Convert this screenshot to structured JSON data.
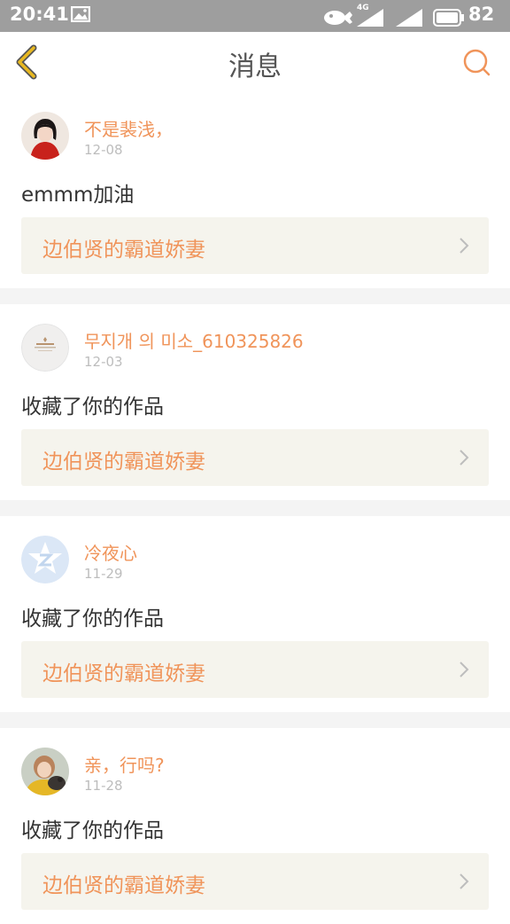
{
  "status_bar": {
    "time": "20:41",
    "network": "4G",
    "battery": "82",
    "icons": [
      "image-notification-icon",
      "cloud-icon",
      "signal-icon",
      "signal-icon",
      "battery-icon"
    ]
  },
  "header": {
    "title": "消息",
    "back_icon": "chevron-left-icon",
    "search_icon": "search-icon"
  },
  "colors": {
    "accent": "#f0945a",
    "text": "#333333",
    "muted": "#bdbdbd",
    "card_bg": "#f5f4ed",
    "separator": "#f4f4f4",
    "back_icon": "#e8b820",
    "status_bar": "#9e9e9e"
  },
  "messages": [
    {
      "user": "不是裴浅，",
      "date": "12-08",
      "text": "emmm加油",
      "work_title": "边伯贤的霸道娇妻",
      "avatar": "photo-avatar-red"
    },
    {
      "user": "무지개 의 미소_610325826",
      "date": "12-03",
      "text": "收藏了你的作品",
      "work_title": "边伯贤的霸道娇妻",
      "avatar": "logo-avatar"
    },
    {
      "user": "冷夜心",
      "date": "11-29",
      "text": "收藏了你的作品",
      "work_title": "边伯贤的霸道娇妻",
      "avatar": "qzone-star-avatar"
    },
    {
      "user": "亲，行吗?",
      "date": "11-28",
      "text": "收藏了你的作品",
      "work_title": "边伯贤的霸道娇妻",
      "avatar": "photo-avatar-dog"
    }
  ]
}
